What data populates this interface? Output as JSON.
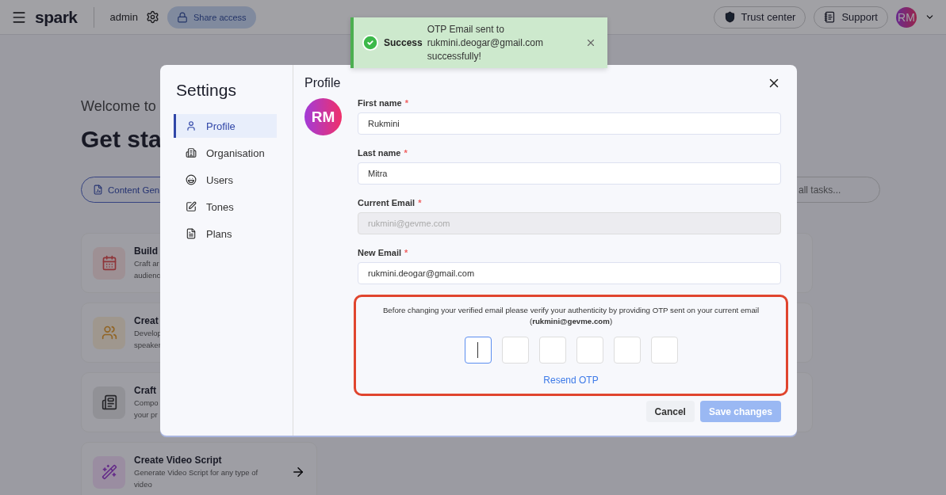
{
  "header": {
    "brand": "spark",
    "user": "admin",
    "share_button": "Share access",
    "trust_button": "Trust center",
    "support_button": "Support",
    "avatar": "RM"
  },
  "background": {
    "greeting": "Welcome to",
    "heading": "Get sta",
    "chip": "Content Gen",
    "search": {
      "placeholder": "all tasks..."
    },
    "cards": [
      {
        "kind": "calendar",
        "title": "Build",
        "lines": [
          "Craft ar",
          "audienc"
        ]
      },
      {
        "kind": "people",
        "title": "Creat",
        "lines": [
          "Develop",
          "speaker"
        ]
      },
      {
        "kind": "news",
        "title": "Craft",
        "lines": [
          "Compo",
          "your pr"
        ]
      },
      {
        "kind": "wand",
        "title": "Create Video Script",
        "lines": [
          "Generate Video Script for any type of",
          "video"
        ]
      }
    ]
  },
  "toast": {
    "title": "Success",
    "message": "OTP Email sent to rukmini.deogar@gmail.com successfully!"
  },
  "modal": {
    "title": "Settings",
    "nav": [
      {
        "kind": "user",
        "label": "Profile",
        "selected": true
      },
      {
        "kind": "building",
        "label": "Organisation",
        "selected": false
      },
      {
        "kind": "face",
        "label": "Users",
        "selected": false
      },
      {
        "kind": "pen",
        "label": "Tones",
        "selected": false
      },
      {
        "kind": "doc",
        "label": "Plans",
        "selected": false
      }
    ],
    "section_title": "Profile",
    "avatar": "RM",
    "fields": [
      {
        "label": "First name",
        "mark": "*",
        "value": "Rukmini",
        "disabled": false
      },
      {
        "label": "Last name",
        "mark": "*",
        "value": "Mitra",
        "disabled": false
      },
      {
        "label": "Current Email",
        "mark": "*",
        "value": "rukmini@gevme.com",
        "disabled": true
      },
      {
        "label": "New Email",
        "mark": "*",
        "value": "rukmini.deogar@gmail.com",
        "disabled": false
      }
    ],
    "otp": {
      "message": "Before changing your verified email please verify your authenticity by providing OTP sent on your current email (**rukmini@gevme.com**)",
      "digits": [
        {
          "focused": true
        },
        {
          "focused": false
        },
        {
          "focused": false
        },
        {
          "focused": false
        },
        {
          "focused": false
        },
        {
          "focused": false
        }
      ],
      "resend": "Resend OTP"
    },
    "cancel": "Cancel",
    "save": {
      "label": "Save changes",
      "disabled": true
    }
  }
}
